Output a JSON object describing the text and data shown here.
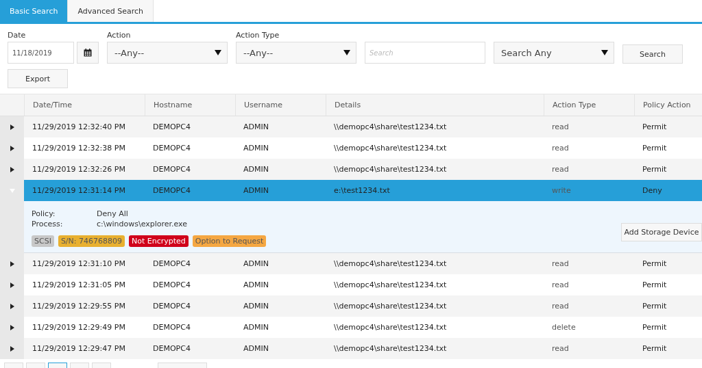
{
  "tabs": [
    {
      "label": "Basic Search",
      "selected": true
    },
    {
      "label": "Advanced Search",
      "selected": false
    }
  ],
  "filters": {
    "date": {
      "label": "Date",
      "value": "11/18/2019"
    },
    "action": {
      "label": "Action",
      "value": "--Any--"
    },
    "action_type": {
      "label": "Action Type",
      "value": "--Any--"
    },
    "search": {
      "placeholder": "Search"
    },
    "search_mode": {
      "value": "Search Any"
    },
    "search_button": "Search",
    "export_button": "Export"
  },
  "table": {
    "columns": [
      "Date/Time",
      "Hostname",
      "Username",
      "Details",
      "Action Type",
      "Policy Action"
    ],
    "rows": [
      {
        "cells": [
          "11/29/2019 12:32:40 PM",
          "DEMOPC4",
          "ADMIN",
          "\\\\demopc4\\share\\test1234.txt",
          "read",
          "Permit"
        ],
        "selected": false,
        "expanded": false
      },
      {
        "cells": [
          "11/29/2019 12:32:38 PM",
          "DEMOPC4",
          "ADMIN",
          "\\\\demopc4\\share\\test1234.txt",
          "read",
          "Permit"
        ],
        "selected": false,
        "expanded": false
      },
      {
        "cells": [
          "11/29/2019 12:32:26 PM",
          "DEMOPC4",
          "ADMIN",
          "\\\\demopc4\\share\\test1234.txt",
          "read",
          "Permit"
        ],
        "selected": false,
        "expanded": false
      },
      {
        "cells": [
          "11/29/2019 12:31:14 PM",
          "DEMOPC4",
          "ADMIN",
          "e:\\test1234.txt",
          "write",
          "Deny"
        ],
        "selected": true,
        "expanded": true,
        "detail": {
          "fields": [
            {
              "label": "Policy:",
              "value": "Deny All"
            },
            {
              "label": "Process:",
              "value": "c:\\windows\\explorer.exe"
            }
          ],
          "tags": [
            {
              "text": "SCSI",
              "color": "#c8c8c8"
            },
            {
              "text": "S/N: 746768809",
              "color": "#e8b030"
            },
            {
              "text": "Not Encrypted",
              "color": "#d0021b"
            },
            {
              "text": "Option to Request",
              "color": "#f5a742"
            }
          ],
          "button": "Add Storage Device"
        }
      },
      {
        "cells": [
          "11/29/2019 12:31:10 PM",
          "DEMOPC4",
          "ADMIN",
          "\\\\demopc4\\share\\test1234.txt",
          "read",
          "Permit"
        ],
        "selected": false,
        "expanded": false
      },
      {
        "cells": [
          "11/29/2019 12:31:05 PM",
          "DEMOPC4",
          "ADMIN",
          "\\\\demopc4\\share\\test1234.txt",
          "read",
          "Permit"
        ],
        "selected": false,
        "expanded": false
      },
      {
        "cells": [
          "11/29/2019 12:29:55 PM",
          "DEMOPC4",
          "ADMIN",
          "\\\\demopc4\\share\\test1234.txt",
          "read",
          "Permit"
        ],
        "selected": false,
        "expanded": false
      },
      {
        "cells": [
          "11/29/2019 12:29:49 PM",
          "DEMOPC4",
          "ADMIN",
          "\\\\demopc4\\share\\test1234.txt",
          "delete",
          "Permit"
        ],
        "selected": false,
        "expanded": false
      },
      {
        "cells": [
          "11/29/2019 12:29:47 PM",
          "DEMOPC4",
          "ADMIN",
          "\\\\demopc4\\share\\test1234.txt",
          "read",
          "Permit"
        ],
        "selected": false,
        "expanded": false
      }
    ]
  }
}
